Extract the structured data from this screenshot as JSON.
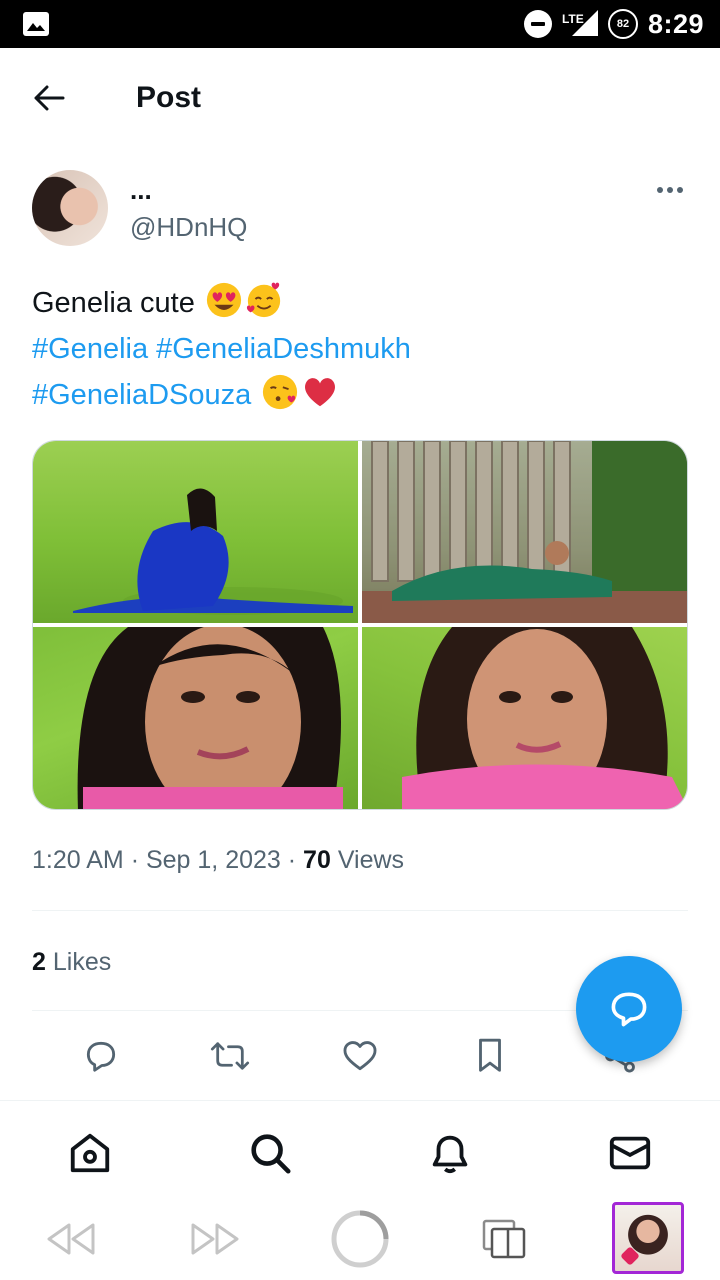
{
  "status_bar": {
    "time": "8:29",
    "network": "LTE",
    "battery": "82"
  },
  "header": {
    "title": "Post"
  },
  "author": {
    "display_name": "...",
    "handle": "@HDnHQ"
  },
  "post": {
    "text": "Genelia cute",
    "hashtags": [
      "#Genelia",
      "#GeneliaDeshmukh",
      "#GeneliaDSouza"
    ],
    "emojis_line1": [
      "smiling-face-with-heart-eyes-emoji",
      "smiling-face-with-hearts-emoji"
    ],
    "emojis_line3": [
      "face-blowing-kiss-emoji",
      "red-heart-emoji"
    ],
    "image_count": 4
  },
  "meta": {
    "time": "1:20 AM",
    "separator": "·",
    "date": "Sep 1, 2023",
    "views_count": "70",
    "views_label": "Views"
  },
  "likes": {
    "count": "2",
    "label": "Likes"
  },
  "actions": [
    "reply-icon",
    "retweet-icon",
    "like-icon",
    "bookmark-icon",
    "share-icon"
  ],
  "bottom_nav": [
    "home-icon",
    "search-icon",
    "notifications-icon",
    "messages-icon"
  ],
  "colors": {
    "accent": "#1d9bf0",
    "text": "#0f1419",
    "secondary": "#536471",
    "divider": "#eff3f4"
  }
}
